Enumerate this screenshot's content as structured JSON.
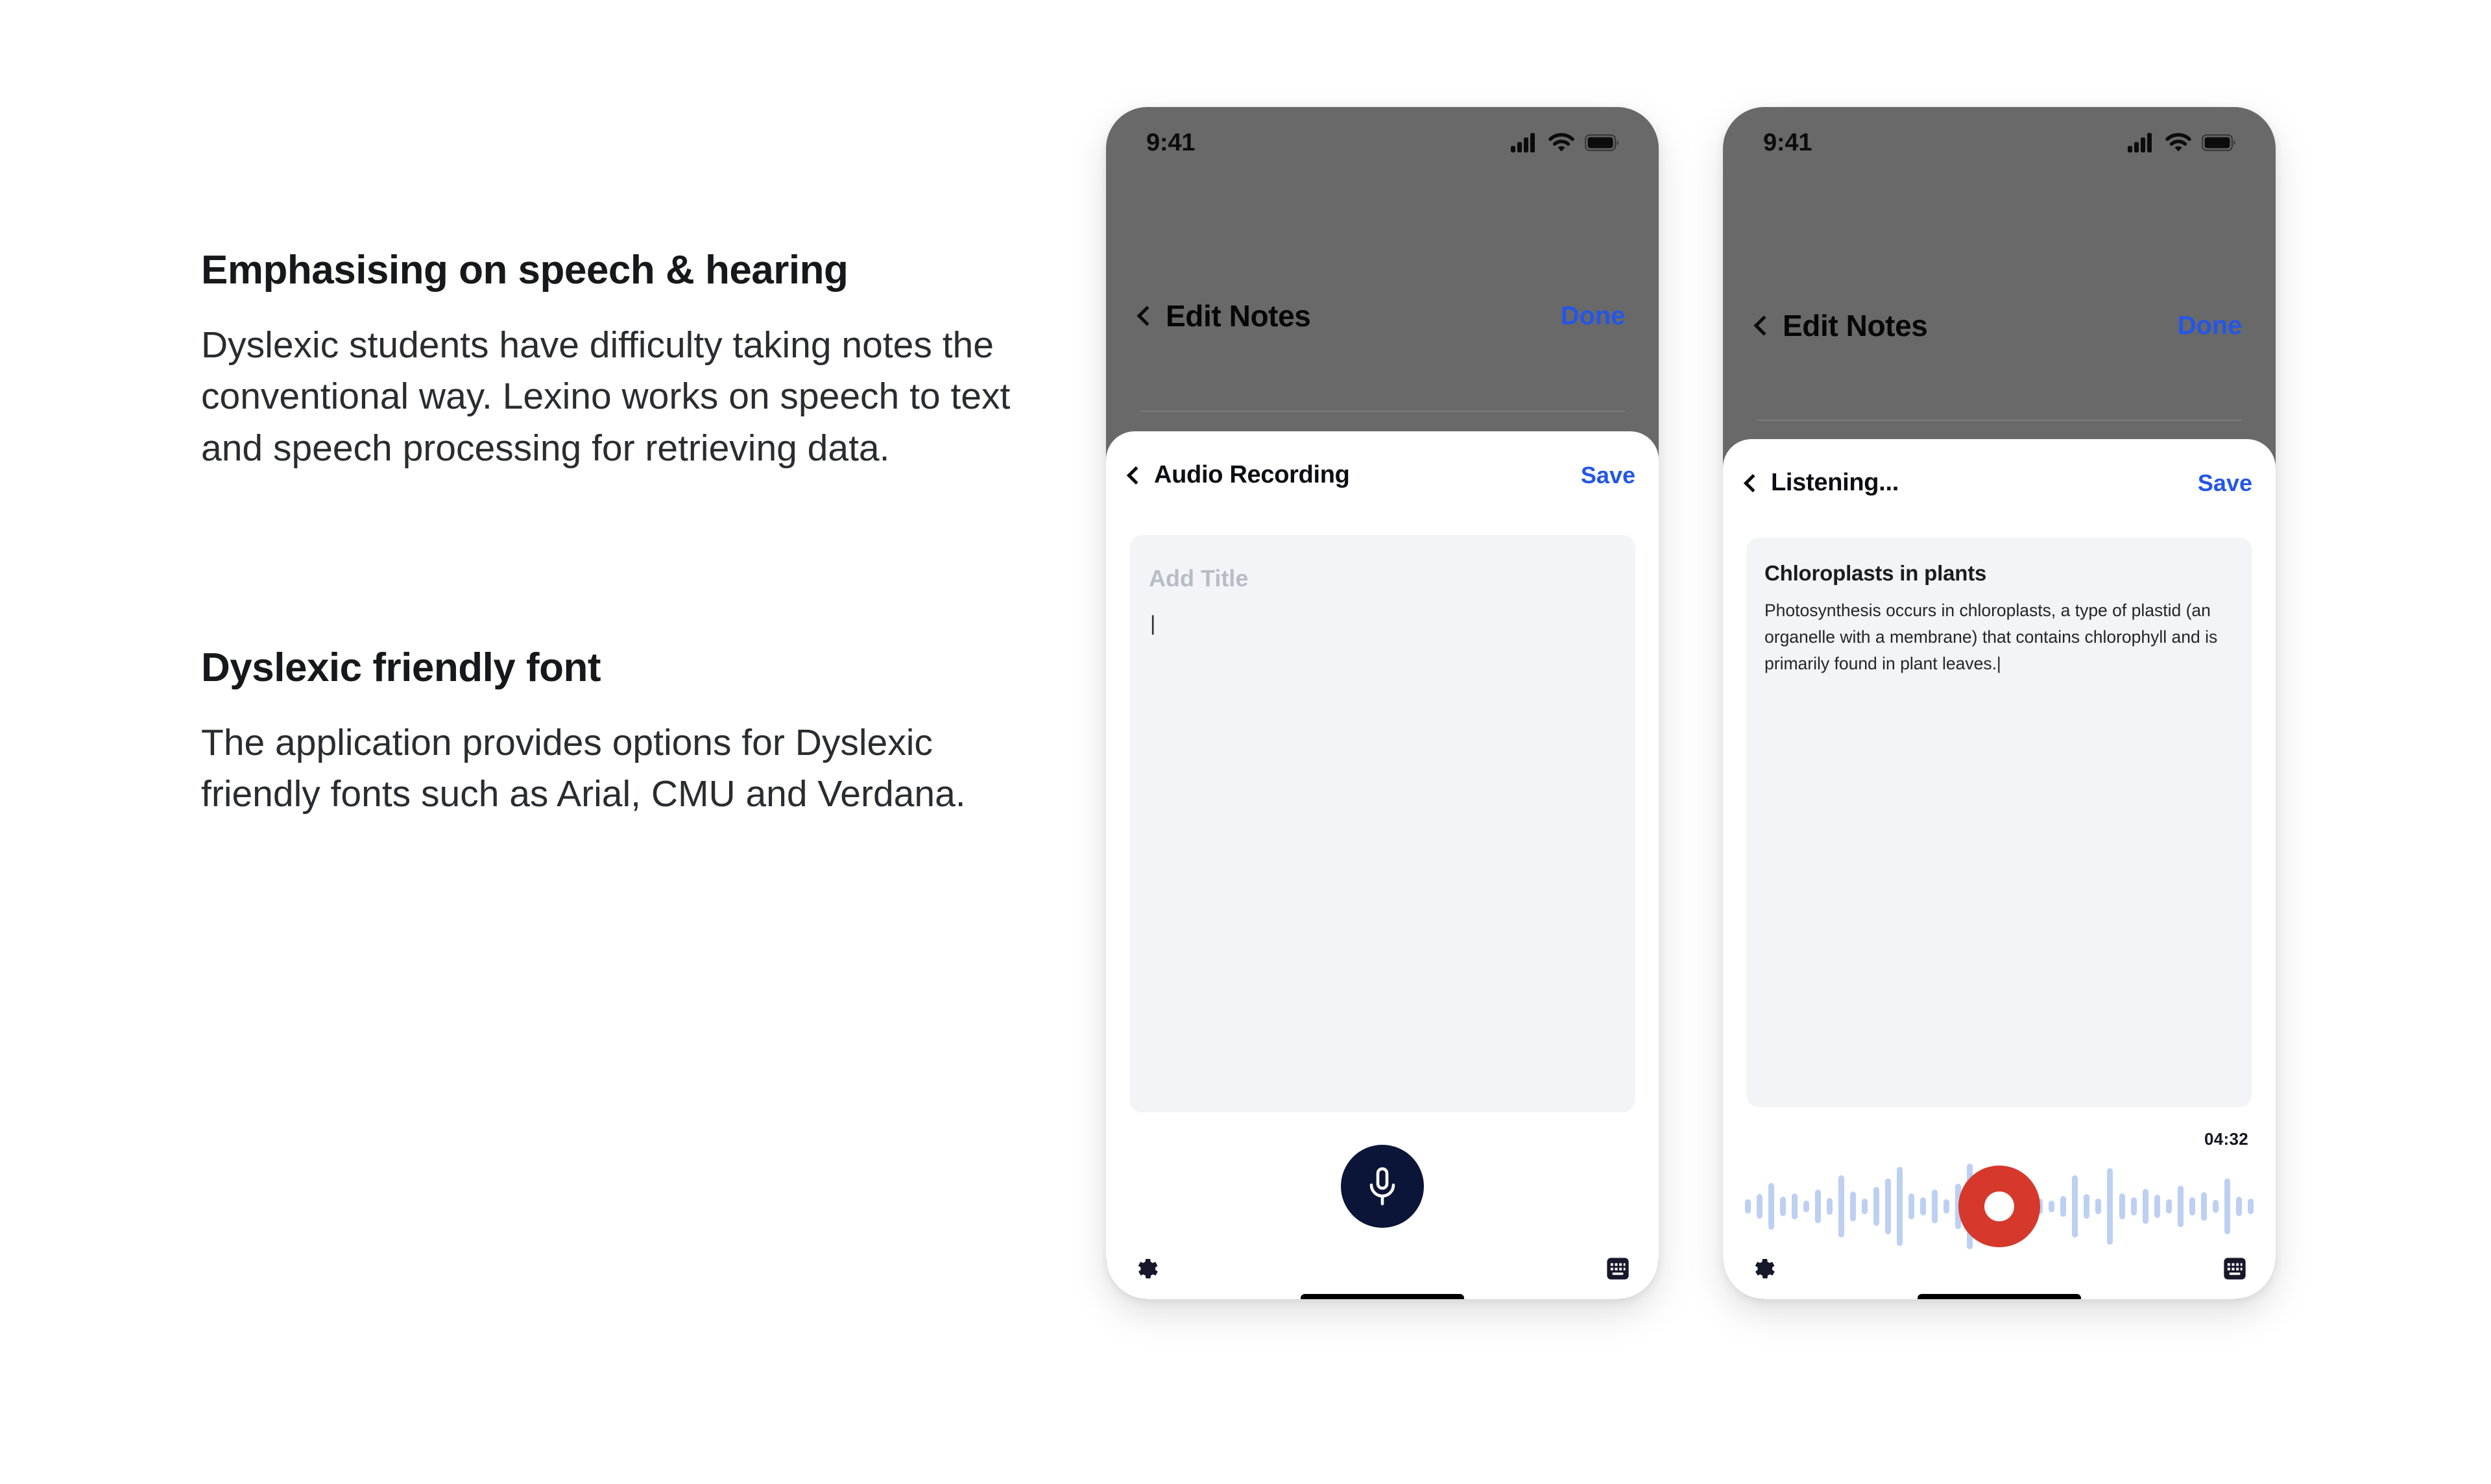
{
  "copy": {
    "sections": [
      {
        "heading": "Emphasising on speech & hearing",
        "body": "Dyslexic students have difficulty taking notes the conventional way. Lexino works on speech to text and speech processing for retrieving data."
      },
      {
        "heading": "Dyslexic friendly font",
        "body": "The application provides options for Dyslexic friendly fonts such as Arial, CMU and Verdana."
      }
    ]
  },
  "colors": {
    "dim_overlay": "#696969",
    "accent_blue": "#2456e8",
    "mic_navy": "#0b1538",
    "record_red": "#d6382c",
    "waveform_blue": "#bdd0f2",
    "card_grey": "#f2f4f8"
  },
  "phones": [
    {
      "status": {
        "time": "9:41",
        "icons": [
          "cellular-signal-icon",
          "wifi-icon",
          "battery-icon"
        ]
      },
      "background_nav": {
        "back_icon": "chevron-left-icon",
        "title": "Edit Notes",
        "action": "Done"
      },
      "sheet": {
        "back_icon": "chevron-left-icon",
        "title": "Audio Recording",
        "action": "Save",
        "note": {
          "title_placeholder": "Add Title",
          "caret": "|",
          "title": "",
          "body": ""
        },
        "mic_button_icon": "microphone-icon"
      },
      "bottom": {
        "settings_icon": "gear-icon",
        "keyboard_icon": "keyboard-icon"
      }
    },
    {
      "status": {
        "time": "9:41",
        "icons": [
          "cellular-signal-icon",
          "wifi-icon",
          "battery-icon"
        ]
      },
      "background_nav": {
        "back_icon": "chevron-left-icon",
        "title": "Edit Notes",
        "action": "Done"
      },
      "sheet": {
        "back_icon": "chevron-left-icon",
        "title": "Listening...",
        "action": "Save",
        "note": {
          "title_placeholder": "",
          "caret": "|",
          "title": "Chloroplasts in plants",
          "body": "Photosynthesis occurs in chloroplasts, a type of plastid (an organelle with a membrane) that contains chlorophyll and is primarily found in plant leaves.|"
        },
        "record_button_icon": "record-stop-icon",
        "timer": "04:32",
        "waveform": {
          "label": "audio-waveform",
          "bar_heights_pct": [
            22,
            38,
            72,
            30,
            40,
            18,
            52,
            26,
            96,
            46,
            24,
            60,
            86,
            122,
            40,
            28,
            52,
            22,
            70,
            132,
            44,
            26,
            20,
            30,
            62,
            24,
            18,
            32,
            96,
            38,
            24,
            118,
            40,
            28,
            54,
            36,
            22,
            64,
            28,
            44,
            20,
            86,
            30,
            24
          ]
        }
      },
      "bottom": {
        "settings_icon": "gear-icon",
        "keyboard_icon": "keyboard-icon"
      }
    }
  ]
}
